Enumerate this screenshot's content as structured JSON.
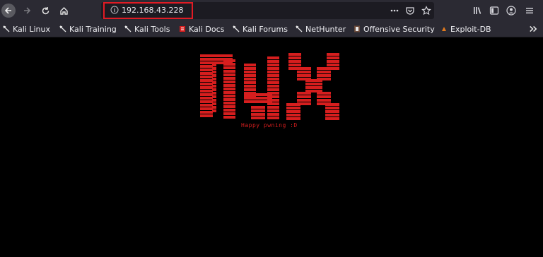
{
  "browser": {
    "url": "192.168.43.228"
  },
  "bookmarks": [
    {
      "label": "Kali Linux",
      "icon": "kali-dragon-icon"
    },
    {
      "label": "Kali Training",
      "icon": "kali-dragon-icon"
    },
    {
      "label": "Kali Tools",
      "icon": "kali-dragon-icon"
    },
    {
      "label": "Kali Docs",
      "icon": "kali-docs-icon"
    },
    {
      "label": "Kali Forums",
      "icon": "kali-dragon-icon"
    },
    {
      "label": "NetHunter",
      "icon": "kali-dragon-icon"
    },
    {
      "label": "Offensive Security",
      "icon": "offsec-icon"
    },
    {
      "label": "Exploit-DB",
      "icon": "exploit-db-icon"
    }
  ],
  "page": {
    "logo_text": "nyx",
    "tagline": "Happy pwning :D"
  },
  "colors": {
    "accent_red": "#d61e1e",
    "toolbar": "#2b2a33",
    "background": "#000000"
  }
}
